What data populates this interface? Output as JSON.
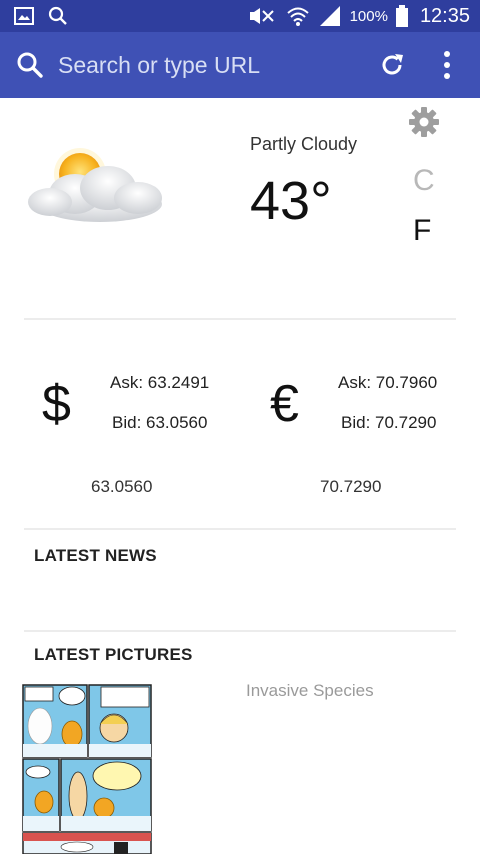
{
  "status_bar": {
    "battery": "100%",
    "time": "12:35"
  },
  "urlbar": {
    "placeholder": "Search or type URL"
  },
  "weather": {
    "condition": "Partly Cloudy",
    "temperature": "43°",
    "unit_c": "C",
    "unit_f": "F"
  },
  "currency": {
    "dollar": {
      "symbol": "$",
      "ask": "Ask: 63.2491",
      "bid": "Bid: 63.0560",
      "value": "63.0560"
    },
    "euro": {
      "symbol": "€",
      "ask": "Ask: 70.7960",
      "bid": "Bid: 70.7290",
      "value": "70.7290"
    }
  },
  "news": {
    "title": "LATEST NEWS"
  },
  "pictures": {
    "title": "LATEST PICTURES",
    "items": [
      {
        "caption": "Invasive Species"
      }
    ]
  },
  "colors": {
    "statusbar": "#2f3e9e",
    "toolbar": "#3f51b5"
  }
}
